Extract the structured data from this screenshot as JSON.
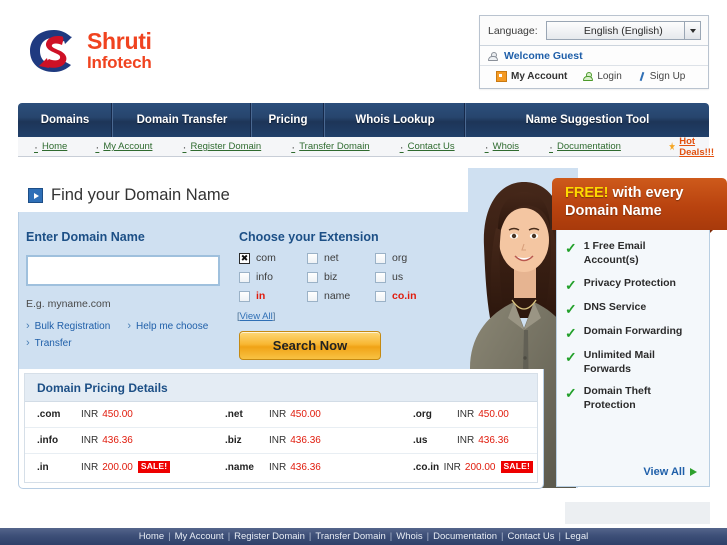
{
  "header": {
    "logo": {
      "line1": "Shruti",
      "line2": "Infotech",
      "mark_name": "shruti-swoosh-logo"
    },
    "language_label": "Language:",
    "language_value": "English (English)",
    "welcome_text": "Welcome Guest",
    "account_links": [
      {
        "label": "My Account",
        "icon": "orange-square-icon"
      },
      {
        "label": "Login",
        "icon": "person-green-icon"
      },
      {
        "label": "Sign Up",
        "icon": "pen-icon"
      }
    ]
  },
  "nav": {
    "items": [
      {
        "label": "Domains"
      },
      {
        "label": "Domain Transfer"
      },
      {
        "label": "Pricing"
      },
      {
        "label": "Whois Lookup"
      },
      {
        "label": "Name Suggestion Tool"
      }
    ]
  },
  "subnav": {
    "items": [
      {
        "label": "Home"
      },
      {
        "label": "My Account"
      },
      {
        "label": "Register Domain"
      },
      {
        "label": "Transfer Domain"
      },
      {
        "label": "Contact Us"
      },
      {
        "label": "Whois"
      },
      {
        "label": "Documentation"
      }
    ],
    "hot_deals": "Hot Deals!!!"
  },
  "main": {
    "title": "Find your Domain Name",
    "enter_domain_label": "Enter Domain Name",
    "domain_input_value": "",
    "domain_input_placeholder": "",
    "example_text": "E.g. myname.com",
    "mini_links": [
      {
        "label": "Bulk Registration"
      },
      {
        "label": "Help me choose"
      },
      {
        "label": "Transfer"
      }
    ],
    "choose_extension_label": "Choose your Extension",
    "extensions": [
      {
        "label": "com",
        "checked": true,
        "red": false
      },
      {
        "label": "net",
        "checked": false,
        "red": false
      },
      {
        "label": "org",
        "checked": false,
        "red": false
      },
      {
        "label": "info",
        "checked": false,
        "red": false
      },
      {
        "label": "biz",
        "checked": false,
        "red": false
      },
      {
        "label": "us",
        "checked": false,
        "red": false
      },
      {
        "label": "in",
        "checked": false,
        "red": true
      },
      {
        "label": "name",
        "checked": false,
        "red": false
      },
      {
        "label": "co.in",
        "checked": false,
        "red": true
      }
    ],
    "view_all_small": "View All",
    "search_button": "Search Now"
  },
  "pricing": {
    "title": "Domain Pricing Details",
    "currency": "INR",
    "sale_badge": "SALE!",
    "rows": [
      [
        {
          "tld": ".com",
          "currency": "INR",
          "price": "450.00",
          "sale": false
        },
        {
          "tld": ".net",
          "currency": "INR",
          "price": "450.00",
          "sale": false
        },
        {
          "tld": ".org",
          "currency": "INR",
          "price": "450.00",
          "sale": false
        }
      ],
      [
        {
          "tld": ".info",
          "currency": "INR",
          "price": "436.36",
          "sale": false
        },
        {
          "tld": ".biz",
          "currency": "INR",
          "price": "436.36",
          "sale": false
        },
        {
          "tld": ".us",
          "currency": "INR",
          "price": "436.36",
          "sale": false
        }
      ],
      [
        {
          "tld": ".in",
          "currency": "INR",
          "price": "200.00",
          "sale": true
        },
        {
          "tld": ".name",
          "currency": "INR",
          "price": "436.36",
          "sale": false
        },
        {
          "tld": ".co.in",
          "currency": "INR",
          "price": "200.00",
          "sale": true
        }
      ]
    ]
  },
  "promo": {
    "banner_highlight": "FREE!",
    "banner_rest": " with every",
    "banner_line2": "Domain Name",
    "items": [
      {
        "label": "1 Free Email Account(s)"
      },
      {
        "label": "Privacy Protection"
      },
      {
        "label": "DNS Service"
      },
      {
        "label": "Domain Forwarding"
      },
      {
        "label": "Unlimited Mail Forwards"
      },
      {
        "label": "Domain Theft Protection"
      }
    ],
    "view_all": "View All"
  },
  "footer": {
    "links": [
      {
        "label": "Home"
      },
      {
        "label": "My Account"
      },
      {
        "label": "Register Domain"
      },
      {
        "label": "Transfer Domain"
      },
      {
        "label": "Whois"
      },
      {
        "label": "Documentation"
      },
      {
        "label": "Contact Us"
      },
      {
        "label": "Legal"
      }
    ]
  },
  "colors": {
    "nav_blue": "#27456d",
    "accent_red": "#E01B0C",
    "logo_orange": "#F0431F",
    "promo_orange": "#B9430F",
    "link_blue": "#1f5fa9",
    "sale_red": "#EE0000",
    "check_green": "#22A02A",
    "panel_blue": "#cfe0f1"
  }
}
